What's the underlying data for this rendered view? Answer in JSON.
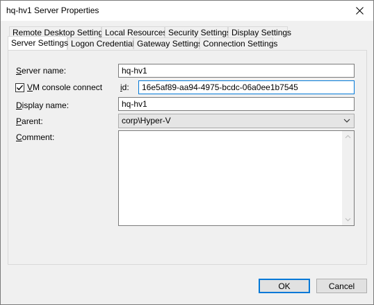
{
  "window": {
    "title": "hq-hv1 Server Properties"
  },
  "tabs": {
    "row1": [
      "Remote Desktop Settings",
      "Local Resources",
      "Security Settings",
      "Display Settings"
    ],
    "row2": [
      "Server Settings",
      "Logon Credentials",
      "Gateway Settings",
      "Connection Settings"
    ],
    "active": "Server Settings"
  },
  "form": {
    "server_name_label_u": "S",
    "server_name_label_rest": "erver name:",
    "server_name_value": "hq-hv1",
    "vm_console_label_u": "V",
    "vm_console_label_rest": "M console connect",
    "vm_console_checked": true,
    "id_label_u": "i",
    "id_label_rest": "d:",
    "id_value": "16e5af89-aa94-4975-bcdc-06a0ee1b7545",
    "display_name_label_u": "D",
    "display_name_label_rest": "isplay name:",
    "display_name_value": "hq-hv1",
    "parent_label_u": "P",
    "parent_label_rest": "arent:",
    "parent_value": "corp\\Hyper-V",
    "comment_label_u": "C",
    "comment_label_rest": "omment:",
    "comment_value": ""
  },
  "buttons": {
    "ok": "OK",
    "cancel": "Cancel"
  },
  "icons": {
    "close": "close-icon",
    "checkmark": "checkmark-icon",
    "dropdown": "chevron-down-icon",
    "scroll_up": "scroll-up-icon",
    "scroll_down": "scroll-down-icon"
  },
  "colors": {
    "focus": "#0078d7",
    "window_bg": "#f0f0f0"
  }
}
